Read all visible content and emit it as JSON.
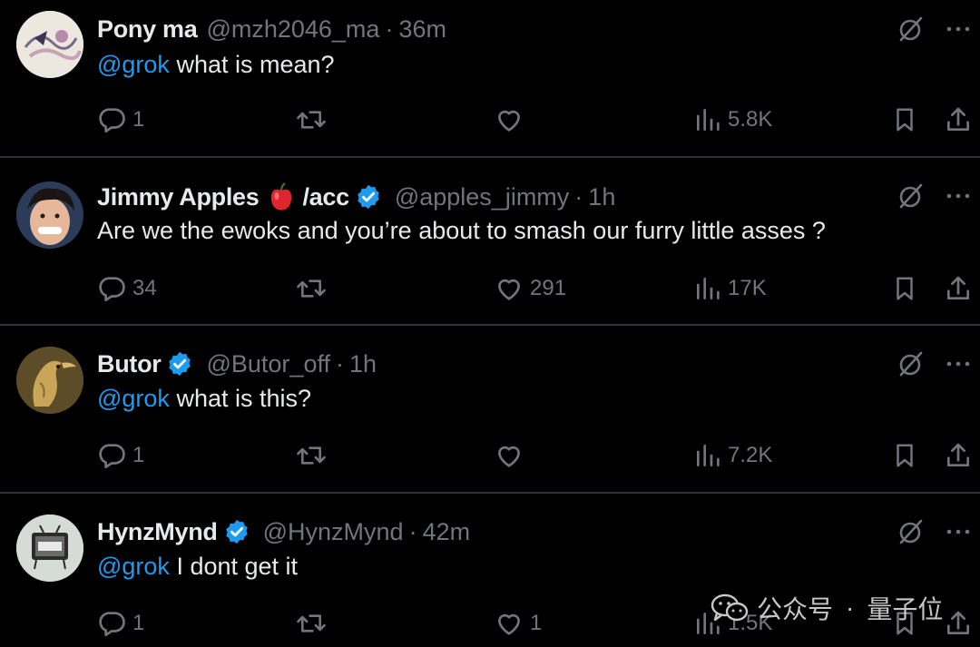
{
  "tweets": [
    {
      "name": "Pony ma",
      "handle": "@mzh2046_ma",
      "sep": "·",
      "time": "36m",
      "mention": "@grok",
      "text": " what is mean?",
      "replies": "1",
      "likes": "",
      "views": "5.8K",
      "verified": false,
      "avatar_color": "#e9e4dc"
    },
    {
      "name": "Jimmy Apples",
      "name_suffix": "/acc",
      "handle": "@apples_jimmy",
      "sep": "·",
      "time": "1h",
      "mention": "",
      "text": "Are we the ewoks and you’re about to smash our furry little asses ?",
      "replies": "34",
      "likes": "291",
      "views": "17K",
      "verified": true,
      "avatar_color": "#2a3a55"
    },
    {
      "name": "Butor",
      "handle": "@Butor_off",
      "sep": "·",
      "time": "1h",
      "mention": "@grok",
      "text": " what is this?",
      "replies": "1",
      "likes": "",
      "views": "7.2K",
      "verified": true,
      "avatar_color": "#6b5a2e"
    },
    {
      "name": "HynzMynd",
      "handle": "@HynzMynd",
      "sep": "·",
      "time": "42m",
      "mention": "@grok",
      "text": " I dont get it",
      "replies": "1",
      "likes": "1",
      "views": "1.5K",
      "verified": true,
      "avatar_color": "#cfd6d2"
    }
  ],
  "watermark": {
    "label": "公众号",
    "dot": "·",
    "brand": "量子位"
  },
  "colors": {
    "background": "#000000",
    "text": "#e7e9ea",
    "muted": "#71767b",
    "accent": "#1d9bf0",
    "divider": "#2f3336"
  },
  "icons": [
    "reply-icon",
    "retweet-icon",
    "like-icon",
    "views-icon",
    "bookmark-icon",
    "share-icon",
    "grok-icon",
    "more-icon",
    "verified-icon",
    "apple-icon",
    "wechat-icon"
  ]
}
